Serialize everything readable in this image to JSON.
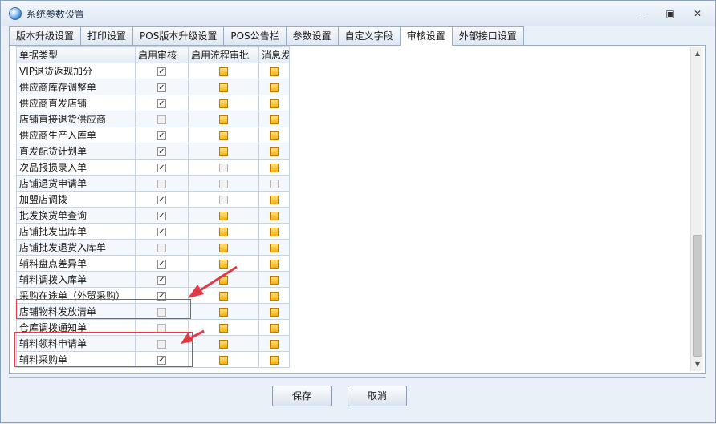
{
  "window": {
    "title": "系统参数设置"
  },
  "tabs": [
    {
      "label": "版本升级设置"
    },
    {
      "label": "打印设置"
    },
    {
      "label": "POS版本升级设置"
    },
    {
      "label": "POS公告栏"
    },
    {
      "label": "参数设置"
    },
    {
      "label": "自定义字段"
    },
    {
      "label": "审核设置"
    },
    {
      "label": "外部接口设置"
    }
  ],
  "active_tab": "审核设置",
  "grid": {
    "headers": [
      "单据类型",
      "启用审核",
      "启用流程审批",
      "消息发"
    ],
    "rows": [
      {
        "name": "VIP退货返现加分",
        "audit": true,
        "flow": "orange",
        "msg": "orange"
      },
      {
        "name": "供应商库存调整单",
        "audit": true,
        "flow": "orange",
        "msg": "orange"
      },
      {
        "name": "供应商直发店铺",
        "audit": true,
        "flow": "orange",
        "msg": "orange"
      },
      {
        "name": "店铺直接退货供应商",
        "audit": false,
        "flow": "orange",
        "msg": "orange"
      },
      {
        "name": "供应商生产入库单",
        "audit": true,
        "flow": "orange",
        "msg": "orange"
      },
      {
        "name": "直发配货计划单",
        "audit": true,
        "flow": "orange",
        "msg": "orange"
      },
      {
        "name": "次品报损录入单",
        "audit": true,
        "flow": "grey",
        "msg": "orange"
      },
      {
        "name": "店铺退货申请单",
        "audit": false,
        "flow": "grey",
        "msg": "grey"
      },
      {
        "name": "加盟店调拨",
        "audit": true,
        "flow": "grey",
        "msg": "orange"
      },
      {
        "name": "批发换货单查询",
        "audit": true,
        "flow": "orange",
        "msg": "orange"
      },
      {
        "name": "店铺批发出库单",
        "audit": true,
        "flow": "orange",
        "msg": "orange"
      },
      {
        "name": "店铺批发退货入库单",
        "audit": false,
        "flow": "orange",
        "msg": "orange"
      },
      {
        "name": "辅料盘点差异单",
        "audit": true,
        "flow": "orange",
        "msg": "orange"
      },
      {
        "name": "辅料调拨入库单",
        "audit": true,
        "flow": "orange",
        "msg": "orange"
      },
      {
        "name": "采购在途单（外贸采购）",
        "audit": true,
        "flow": "orange",
        "msg": "orange"
      },
      {
        "name": "店铺物料发放清单",
        "audit": false,
        "flow": "orange",
        "msg": "orange"
      },
      {
        "name": "仓库调拨通知单",
        "audit": false,
        "flow": "orange",
        "msg": "orange"
      },
      {
        "name": "辅料领料申请单",
        "audit": false,
        "flow": "orange",
        "msg": "orange"
      },
      {
        "name": "辅料采购单",
        "audit": true,
        "flow": "orange",
        "msg": "orange"
      }
    ]
  },
  "buttons": {
    "save": "保存",
    "cancel": "取消"
  },
  "annotation_color": "#e23a45",
  "checkbox_mark": "✓"
}
